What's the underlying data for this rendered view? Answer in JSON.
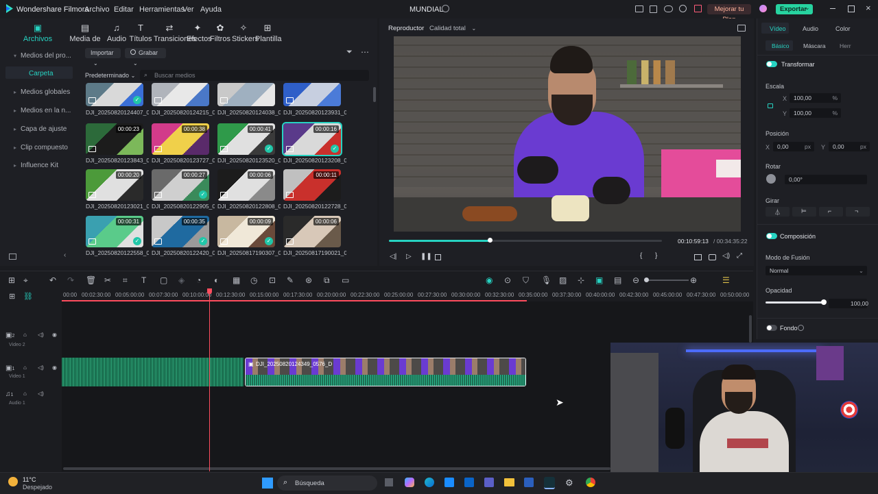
{
  "window": {
    "app_title": "Wondershare Filmora",
    "project_name": "MUNDIAL",
    "upgrade_label": "Mejorar tu Plan",
    "export_label": "Exportar"
  },
  "menu": [
    "Archivo",
    "Editar",
    "Herramientas",
    "Ver",
    "Ayuda"
  ],
  "media_tabs": [
    "Archivos multimedia",
    "Media de Stock",
    "Audio",
    "Títulos",
    "Transiciones",
    "Efectos",
    "Filtros",
    "Stickers",
    "Plantilla"
  ],
  "library": {
    "items": [
      "Medios del pro...",
      "Carpeta",
      "Medios globales",
      "Medios en la n...",
      "Capa de ajuste",
      "Clip compuesto",
      "Influence Kit"
    ]
  },
  "media": {
    "import_label": "Importar",
    "record_label": "Grabar",
    "sort_label": "Predeterminado",
    "search_placeholder": "Buscar medios",
    "rows": [
      [
        {
          "name": "DJI_20250820124407_0...",
          "dur": "",
          "check": true
        },
        {
          "name": "DJI_20250820124215_0...",
          "dur": "",
          "check": false
        },
        {
          "name": "DJI_20250820124038_0...",
          "dur": "",
          "check": false
        },
        {
          "name": "DJI_20250820123931_0...",
          "dur": "",
          "check": false
        }
      ],
      [
        {
          "name": "DJI_20250820123843_0...",
          "dur": "00:00:23",
          "check": false
        },
        {
          "name": "DJI_20250820123727_0...",
          "dur": "00:00:38",
          "check": false
        },
        {
          "name": "DJI_20250820123520_0...",
          "dur": "00:00:41",
          "check": true
        },
        {
          "name": "DJI_20250820123208_0...",
          "dur": "00:00:16",
          "check": true
        }
      ],
      [
        {
          "name": "DJI_20250820123021_0...",
          "dur": "00:00:20",
          "check": false
        },
        {
          "name": "DJI_20250820122905_0...",
          "dur": "00:00:27",
          "check": true
        },
        {
          "name": "DJI_20250820122808_0...",
          "dur": "00:00:06",
          "check": false
        },
        {
          "name": "DJI_20250820122728_0...",
          "dur": "00:00:11",
          "check": false
        }
      ],
      [
        {
          "name": "DJI_20250820122558_0...",
          "dur": "00:00:31",
          "check": true
        },
        {
          "name": "DJI_20250820122420_0...",
          "dur": "00:00:35",
          "check": true
        },
        {
          "name": "DJI_20250817190307_0...",
          "dur": "00:00:09",
          "check": true
        },
        {
          "name": "DJI_20250817190021_0...",
          "dur": "00:00:06",
          "check": false
        }
      ]
    ]
  },
  "player": {
    "tab_label": "Reproductor",
    "quality_label": "Calidad total",
    "current_time": "00:10:59:13",
    "total_time": "/ 00:34:35:22",
    "progress": 0.37
  },
  "props": {
    "tabs": [
      "Vídeo",
      "Audio",
      "Color"
    ],
    "subtabs": [
      "Básico",
      "Máscara",
      "Herr"
    ],
    "transform_label": "Transformar",
    "scale_label": "Escala",
    "scale_x": "100,00",
    "scale_y": "100,00",
    "percent": "%",
    "position_label": "Posición",
    "pos_x": "0,00",
    "pos_y": "0,00",
    "px": "px",
    "rotate_label": "Rotar",
    "rotate_value": "0,00°",
    "flip_label": "Girar",
    "composition_label": "Composición",
    "blend_label": "Modo de Fusión",
    "blend_value": "Normal",
    "opacity_label": "Opacidad",
    "opacity_value": "100,00",
    "background_label": "Fondo"
  },
  "timeline": {
    "ticks": [
      "00:00",
      "00:02:30:00",
      "00:05:00:00",
      "00:07:30:00",
      "00:10:00:00",
      "00:12:30:00",
      "00:15:00:00",
      "00:17:30:00",
      "00:20:00:00",
      "00:22:30:00",
      "00:25:00:00",
      "00:27:30:00",
      "00:30:00:00",
      "00:32:30:00",
      "00:35:00:00",
      "00:37:30:00",
      "00:40:00:00",
      "00:42:30:00",
      "00:45:00:00",
      "00:47:30:00",
      "00:50:00:00"
    ],
    "tracks": [
      {
        "num": "2",
        "name": "Video 2"
      },
      {
        "num": "1",
        "name": "Video 1"
      },
      {
        "num": "1",
        "name": "Audio 1"
      }
    ],
    "clip_label": "DJI_20250820124349_0576_D"
  },
  "taskbar": {
    "temp": "11°C",
    "weather": "Despejado",
    "search_placeholder": "Búsqueda"
  },
  "colors": {
    "accent": "#27d3c2",
    "playhead": "#ff4d5e",
    "export": "#27d3a0"
  }
}
